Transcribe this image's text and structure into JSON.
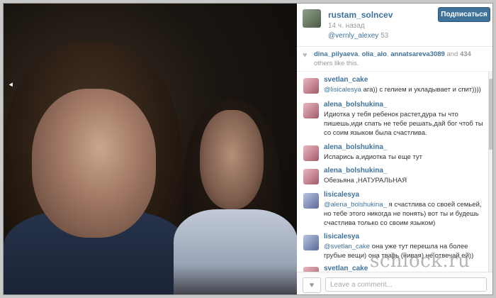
{
  "post": {
    "username": "rustam_solncev",
    "time": "14 ч. назад",
    "tagline_user": "@vernly_alexey",
    "tagline_count": "53",
    "follow_label": "Подписаться"
  },
  "likes": {
    "users": [
      "dina_pilyaeva",
      "olia_alo",
      "annatsareva3089"
    ],
    "sep1": ", ",
    "sep2": ", ",
    "and_text": " and ",
    "count": "434",
    "suffix": " others like this."
  },
  "comments": [
    {
      "user": "svetlan_cake",
      "mention": "@lisicalesya",
      "text": " ага)) с гелием и укладывает и спит))))"
    },
    {
      "user": "alena_bolshukina_",
      "mention": "",
      "text": "Идиотка у тебя ребенок растет,дура ты что пишешь,иди спать не тебе решать,дай бог чтоб ты со соим языком была счастлива."
    },
    {
      "user": "alena_bolshukina_",
      "mention": "",
      "text": "Испарись а,идиотка ты еще тут"
    },
    {
      "user": "alena_bolshukina_",
      "mention": "",
      "text": "Обезьяна ,НАТУРАЛЬНАЯ"
    },
    {
      "user": "lisicalesya",
      "mention": "@alena_bolshukina_",
      "text": " я счастлива со своей семьей, но тебе этого никогда не понять) вот ты и будешь счастлива только со своим языком)"
    },
    {
      "user": "lisicalesya",
      "mention": "@svetlan_cake",
      "text": " она уже тут перешла на более грубые вещи) она тварь (нивая) не отвечай ей))"
    },
    {
      "user": "svetlan_cake",
      "mention": "",
      "text": ""
    }
  ],
  "footer": {
    "input_placeholder": "Leave a comment...",
    "heart_glyph": "♥"
  },
  "watermark": "schlock.ru",
  "colors": {
    "accent": "#3f729b"
  }
}
